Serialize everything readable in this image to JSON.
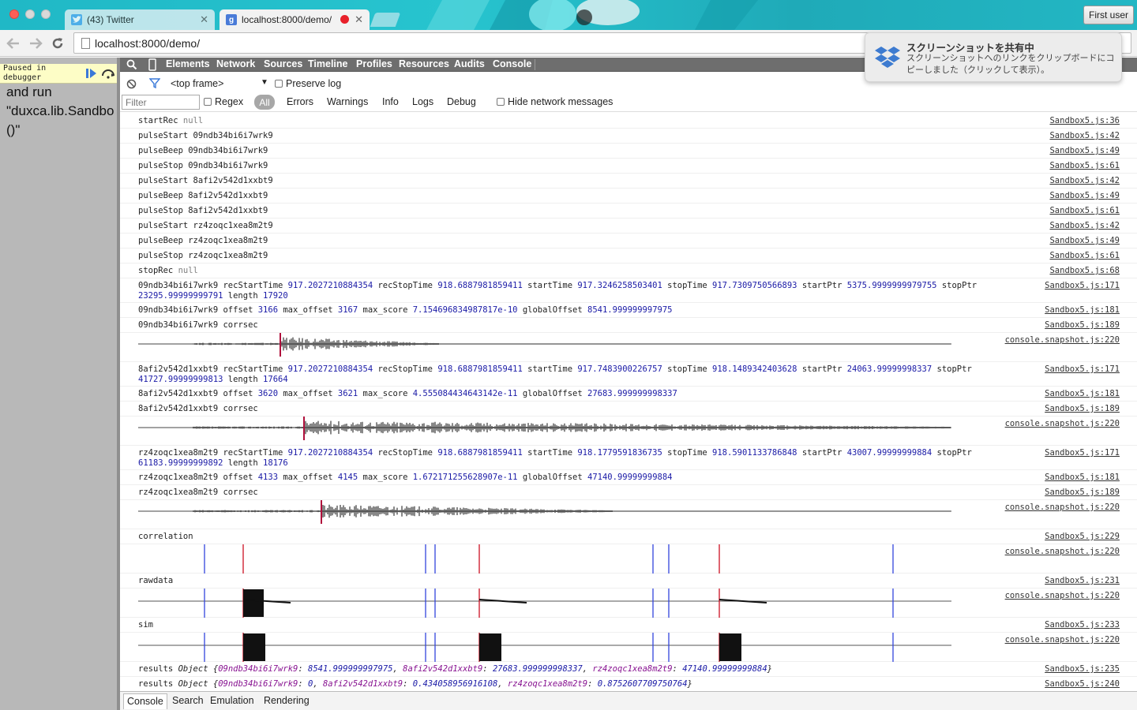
{
  "browser": {
    "tabs": [
      {
        "title": "(43) Twitter"
      },
      {
        "title": "localhost:8000/demo/"
      }
    ],
    "url": "localhost:8000/demo/",
    "profile_button": "First user"
  },
  "notification": {
    "title": "スクリーンショットを共有中",
    "body": "スクリーンショットへのリンクをクリップボードにコピーしました（クリックして表示）。"
  },
  "page": {
    "paused_banner": "Paused in debugger",
    "text": "and run \"duxca.lib.Sandbo ()\""
  },
  "devtools": {
    "tabs": [
      "Elements",
      "Network",
      "Sources",
      "Timeline",
      "Profiles",
      "Resources",
      "Audits",
      "Console"
    ],
    "frame_select": "<top frame>",
    "preserve_log": "Preserve log",
    "filter_placeholder": "Filter",
    "regex_label": "Regex",
    "levels": [
      "All",
      "Errors",
      "Warnings",
      "Info",
      "Logs",
      "Debug"
    ],
    "hide_network": "Hide network messages",
    "drawer_tabs": [
      "Console",
      "Search",
      "Emulation",
      "Rendering"
    ],
    "console": {
      "m1": {
        "label": "startRec",
        "val": "null",
        "src": "Sandbox5.js:36"
      },
      "m2": {
        "label": "pulseStart",
        "val": "09ndb34bi6i7wrk9",
        "src": "Sandbox5.js:42"
      },
      "m3": {
        "label": "pulseBeep",
        "val": "09ndb34bi6i7wrk9",
        "src": "Sandbox5.js:49"
      },
      "m4": {
        "label": "pulseStop",
        "val": "09ndb34bi6i7wrk9",
        "src": "Sandbox5.js:61"
      },
      "m5": {
        "label": "pulseStart",
        "val": "8afi2v542d1xxbt9",
        "src": "Sandbox5.js:42"
      },
      "m6": {
        "label": "pulseBeep",
        "val": "8afi2v542d1xxbt9",
        "src": "Sandbox5.js:49"
      },
      "m7": {
        "label": "pulseStop",
        "val": "8afi2v542d1xxbt9",
        "src": "Sandbox5.js:61"
      },
      "m8": {
        "label": "pulseStart",
        "val": "rz4zoqc1xea8m2t9",
        "src": "Sandbox5.js:42"
      },
      "m9": {
        "label": "pulseBeep",
        "val": "rz4zoqc1xea8m2t9",
        "src": "Sandbox5.js:49"
      },
      "m10": {
        "label": "pulseStop",
        "val": "rz4zoqc1xea8m2t9",
        "src": "Sandbox5.js:61"
      },
      "m11": {
        "label": "stopRec",
        "val": "null",
        "src": "Sandbox5.js:68"
      },
      "r1": {
        "id": "09ndb34bi6i7wrk9",
        "recStartTime": "917.2027210884354",
        "recStopTime": "918.6887981859411",
        "startTime": "917.3246258503401",
        "stopTime": "917.7309750566893",
        "startPtr": "5375.9999999979755",
        "stopPtr": "23295.99999999791",
        "length": "17920",
        "offset": "3166",
        "max_offset": "3167",
        "max_score": "7.154696834987817e-10",
        "globalOffset": "8541.999999997975",
        "src_rec": "Sandbox5.js:171",
        "src_off": "Sandbox5.js:181",
        "src_corr": "Sandbox5.js:189",
        "src_snap": "console.snapshot.js:220"
      },
      "r2": {
        "id": "8afi2v542d1xxbt9",
        "recStartTime": "917.2027210884354",
        "recStopTime": "918.6887981859411",
        "startTime": "917.7483900226757",
        "stopTime": "918.1489342403628",
        "startPtr": "24063.99999998337",
        "stopPtr": "41727.99999999813",
        "length": "17664",
        "offset": "3620",
        "max_offset": "3621",
        "max_score": "4.555084434643142e-11",
        "globalOffset": "27683.999999998337",
        "src_rec": "Sandbox5.js:171",
        "src_off": "Sandbox5.js:181",
        "src_corr": "Sandbox5.js:189",
        "src_snap": "console.snapshot.js:220"
      },
      "r3": {
        "id": "rz4zoqc1xea8m2t9",
        "recStartTime": "917.2027210884354",
        "recStopTime": "918.6887981859411",
        "startTime": "918.1779591836735",
        "stopTime": "918.5901133786848",
        "startPtr": "43007.99999999884",
        "stopPtr": "61183.99999999892",
        "length": "18176",
        "offset": "4133",
        "max_offset": "4145",
        "max_score": "1.672171255628907e-11",
        "globalOffset": "47140.99999999884",
        "src_rec": "Sandbox5.js:171",
        "src_off": "Sandbox5.js:181",
        "src_corr": "Sandbox5.js:189",
        "src_snap": "console.snapshot.js:220"
      },
      "correlation": {
        "label": "correlation",
        "src": "Sandbox5.js:229",
        "src_snap": "console.snapshot.js:220"
      },
      "rawdata": {
        "label": "rawdata",
        "src": "Sandbox5.js:231",
        "src_snap": "console.snapshot.js:220"
      },
      "sim": {
        "label": "sim",
        "src": "Sandbox5.js:233",
        "src_snap": "console.snapshot.js:220"
      },
      "results1": {
        "label": "results",
        "type": "Object",
        "k1": "09ndb34bi6i7wrk9",
        "v1": "8541.999999997975",
        "k2": "8afi2v542d1xxbt9",
        "v2": "27683.999999998337",
        "k3": "rz4zoqc1xea8m2t9",
        "v3": "47140.99999999884",
        "src": "Sandbox5.js:235"
      },
      "results2": {
        "label": "results",
        "type": "Object",
        "k1": "09ndb34bi6i7wrk9",
        "v1": "0",
        "k2": "8afi2v542d1xxbt9",
        "v2": "0.434058956916108",
        "k3": "rz4zoqc1xea8m2t9",
        "v3": "0.8752607709750764",
        "src": "Sandbox5.js:240"
      }
    }
  },
  "colors": {
    "accent": "#1a1aa6",
    "marker_blue": "#3344dd",
    "marker_red": "#cc1122"
  }
}
